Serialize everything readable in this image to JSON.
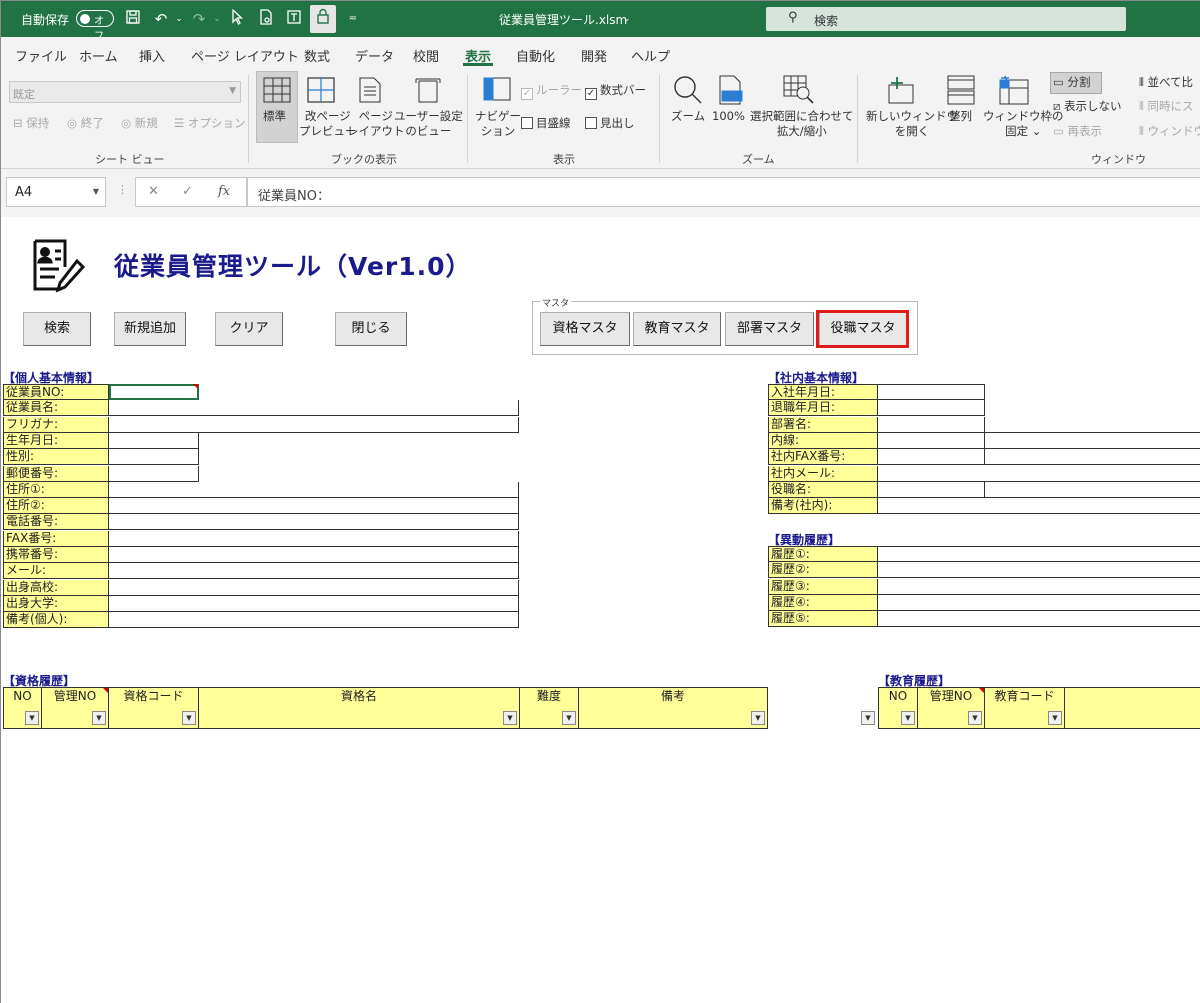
{
  "titlebar": {
    "autosave_label": "自動保存",
    "autosave_state": "オフ",
    "filename": "従業員管理ツール.xlsm",
    "search_placeholder": "検索"
  },
  "menu": {
    "tabs": [
      "ファイル",
      "ホーム",
      "挿入",
      "ページ レイアウト",
      "数式",
      "データ",
      "校閲",
      "表示",
      "自動化",
      "開発",
      "ヘルプ"
    ],
    "active_tab": "表示"
  },
  "ribbon": {
    "sheetview": {
      "select_value": "既定",
      "keep": "保持",
      "exit": "終了",
      "new": "新規",
      "options": "オプション",
      "label": "シート ビュー"
    },
    "workbook_views": {
      "normal": "標準",
      "page_break_1": "改ページ",
      "page_break_2": "プレビュー",
      "page_layout_1": "ページ",
      "page_layout_2": "レイアウト",
      "custom_1": "ユーザー設定",
      "custom_2": "のビュー",
      "label": "ブックの表示"
    },
    "show": {
      "nav_1": "ナビゲー",
      "nav_2": "ション",
      "ruler": "ルーラー",
      "formula_bar": "数式バー",
      "gridlines": "目盛線",
      "headings": "見出し",
      "label": "表示"
    },
    "zoom": {
      "zoom": "ズーム",
      "hundred": "100%",
      "sel_1": "選択範囲に合わせて",
      "sel_2": "拡大/縮小",
      "label": "ズーム"
    },
    "window": {
      "new_1": "新しいウィンドウ",
      "new_2": "を開く",
      "arrange": "整列",
      "freeze_1": "ウィンドウ枠の",
      "freeze_2": "固定",
      "split": "分割",
      "hide": "表示しない",
      "unhide": "再表示",
      "side_by_side": "並べて比",
      "sync": "同時にス",
      "reset": "ウィンドウ",
      "label": "ウィンドウ"
    }
  },
  "formula_bar": {
    "cell_ref": "A4",
    "content": "従業員NO："
  },
  "sheet": {
    "title": "従業員管理ツール（Ver1.0）",
    "buttons": {
      "search": "検索",
      "add": "新規追加",
      "clear": "クリア",
      "close": "閉じる"
    },
    "master": {
      "legend": "マスタ",
      "qualification": "資格マスタ",
      "education": "教育マスタ",
      "department": "部署マスタ",
      "position": "役職マスタ"
    },
    "personal": {
      "title": "【個人基本情報】",
      "labels": [
        "従業員NO:",
        "従業員名:",
        "フリガナ:",
        "生年月日:",
        "性別:",
        "郵便番号:",
        "住所①:",
        "住所②:",
        "電話番号:",
        "FAX番号:",
        "携帯番号:",
        "メール:",
        "出身高校:",
        "出身大学:",
        "備考(個人):"
      ]
    },
    "company": {
      "title": "【社内基本情報】",
      "labels": [
        "入社年月日:",
        "退職年月日:",
        "部署名:",
        "内線:",
        "社内FAX番号:",
        "社内メール:",
        "役職名:",
        "備考(社内):"
      ]
    },
    "transfer": {
      "title": "【異動履歴】",
      "labels": [
        "履歴①:",
        "履歴②:",
        "履歴③:",
        "履歴④:",
        "履歴⑤:"
      ]
    },
    "qualification_history": {
      "title": "【資格履歴】",
      "columns": [
        "NO",
        "管理NO",
        "資格コード",
        "資格名",
        "難度",
        "備考"
      ]
    },
    "education_history": {
      "title": "【教育履歴】",
      "columns": [
        "NO",
        "管理NO",
        "教育コード"
      ]
    }
  }
}
